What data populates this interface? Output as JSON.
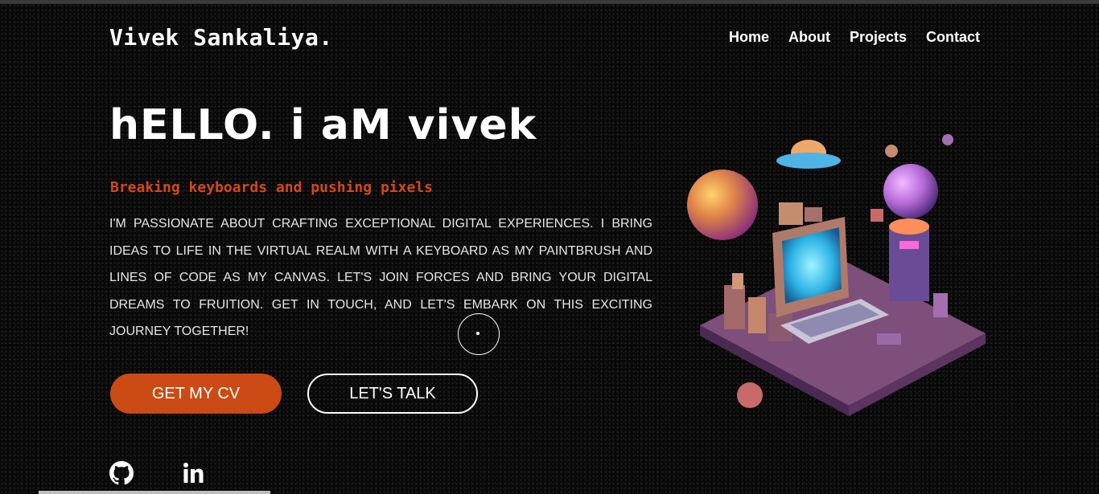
{
  "header": {
    "brand": "Vivek Sankaliya.",
    "nav": [
      {
        "label": "Home"
      },
      {
        "label": "About"
      },
      {
        "label": "Projects"
      },
      {
        "label": "Contact"
      }
    ]
  },
  "hero": {
    "title": "hELLO. i aM vivek",
    "tagline": "Breaking keyboards and pushing pixels",
    "bio": "I'M PASSIONATE ABOUT CRAFTING EXCEPTIONAL DIGITAL EXPERIENCES. I BRING IDEAS TO LIFE IN THE VIRTUAL REALM WITH A KEYBOARD AS MY PAINTBRUSH AND LINES OF CODE AS MY CANVAS. LET'S JOIN FORCES AND BRING YOUR DIGITAL DREAMS TO FRUITION. GET IN TOUCH, AND LET'S EMBARK ON THIS EXCITING JOURNEY TOGETHER!",
    "cv_button": "GET MY CV",
    "talk_button": "LET'S TALK",
    "illustration_icon": "isometric-computer-planets-illustration"
  },
  "social": [
    {
      "icon": "github-icon"
    },
    {
      "icon": "linkedin-icon"
    }
  ],
  "colors": {
    "background": "#0b0b0b",
    "accent": "#cc4a14",
    "tagline": "#d4481a",
    "text": "#ffffff"
  }
}
